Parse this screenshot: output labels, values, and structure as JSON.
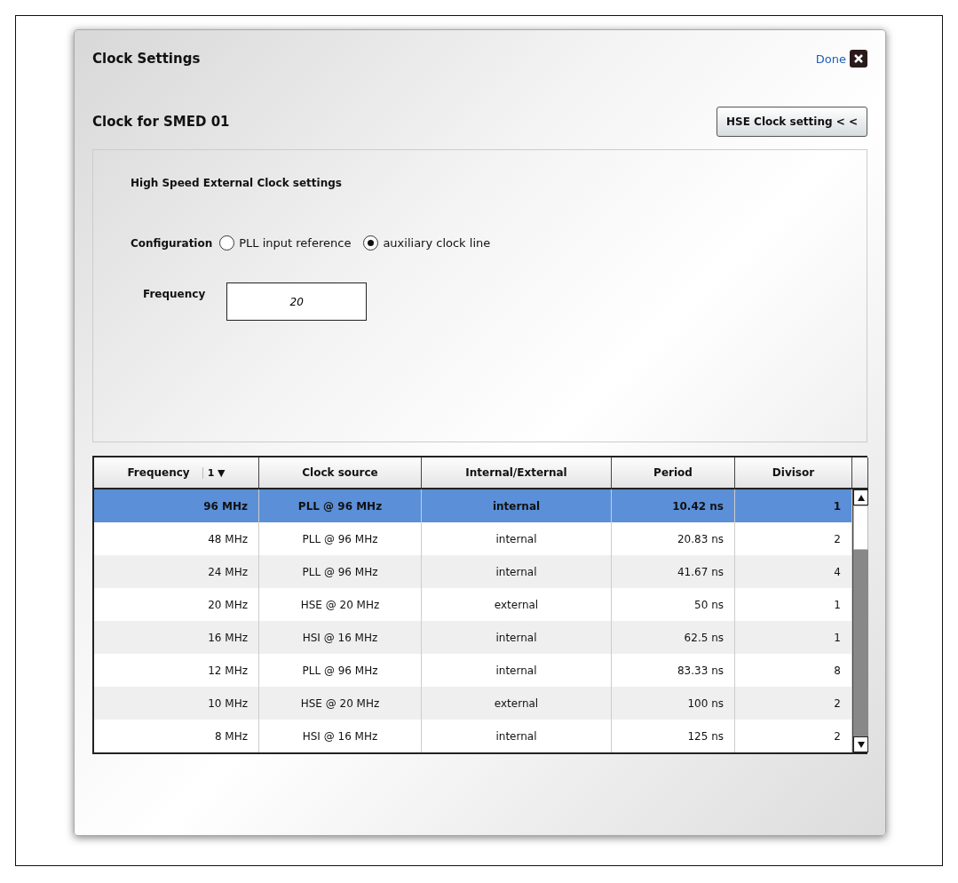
{
  "dialog": {
    "title": "Clock Settings",
    "done_link": "Done"
  },
  "section_title": "Clock for SMED 01",
  "toggle_button": "HSE Clock setting < <",
  "panel": {
    "heading": "High Speed External Clock settings",
    "configuration": {
      "label": "Configuration",
      "options": [
        {
          "label": "PLL input reference",
          "selected": false
        },
        {
          "label": "auxiliary clock line",
          "selected": true
        }
      ]
    },
    "frequency": {
      "label": "Frequency",
      "value": "20"
    }
  },
  "table": {
    "columns": [
      {
        "label": "Frequency",
        "sort": "1 ▼"
      },
      {
        "label": "Clock source"
      },
      {
        "label": "Internal/External"
      },
      {
        "label": "Period"
      },
      {
        "label": "Divisor"
      }
    ],
    "rows": [
      {
        "cells": [
          "96 MHz",
          "PLL @ 96 MHz",
          "internal",
          "10.42 ns",
          "1"
        ],
        "selected": true
      },
      {
        "cells": [
          "48 MHz",
          "PLL @ 96 MHz",
          "internal",
          "20.83 ns",
          "2"
        ],
        "selected": false
      },
      {
        "cells": [
          "24 MHz",
          "PLL @ 96 MHz",
          "internal",
          "41.67 ns",
          "4"
        ],
        "selected": false
      },
      {
        "cells": [
          "20 MHz",
          "HSE @ 20 MHz",
          "external",
          "50 ns",
          "1"
        ],
        "selected": false
      },
      {
        "cells": [
          "16 MHz",
          "HSI @ 16 MHz",
          "internal",
          "62.5 ns",
          "1"
        ],
        "selected": false
      },
      {
        "cells": [
          "12 MHz",
          "PLL @ 96 MHz",
          "internal",
          "83.33 ns",
          "8"
        ],
        "selected": false
      },
      {
        "cells": [
          "10 MHz",
          "HSE @ 20 MHz",
          "external",
          "100 ns",
          "2"
        ],
        "selected": false
      },
      {
        "cells": [
          "8 MHz",
          "HSI @ 16 MHz",
          "internal",
          "125 ns",
          "2"
        ],
        "selected": false
      }
    ]
  }
}
